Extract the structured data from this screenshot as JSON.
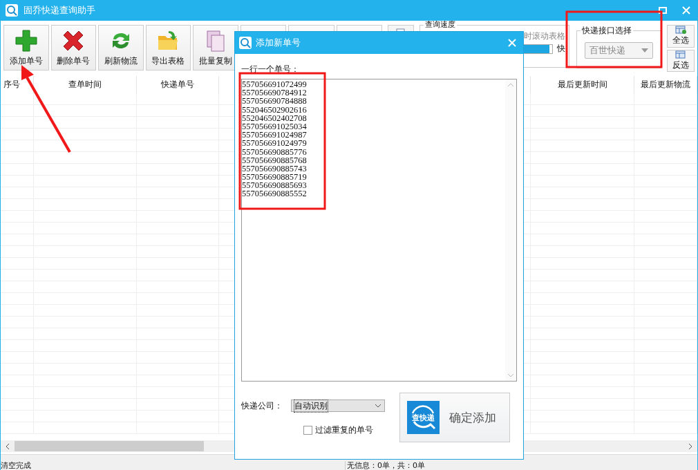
{
  "window": {
    "title": "固乔快递查询助手"
  },
  "toolbar": {
    "buttons": [
      {
        "kind": "add",
        "label": "添加单号"
      },
      {
        "kind": "delete",
        "label": "删除单号"
      },
      {
        "kind": "refresh",
        "label": "刷新物流"
      },
      {
        "kind": "export",
        "label": "导出表格"
      },
      {
        "kind": "copy",
        "label": "批量复制"
      }
    ]
  },
  "speed_group": {
    "title": "查询速度",
    "option_text": "时滚动表格",
    "level": 0.98,
    "end_label": "快"
  },
  "api_group": {
    "title": "快递接口选择",
    "value": "百世快递",
    "disabled": true
  },
  "select_buttons": [
    {
      "kind": "all",
      "label": "全选"
    },
    {
      "kind": "invert",
      "label": "反选"
    }
  ],
  "table": {
    "columns": [
      "序号",
      "查单时间",
      "快递单号",
      "最后更新时间",
      "最后更新物流"
    ]
  },
  "status_bar": {
    "left": "清空完成",
    "right": "无信息：0单，共：0单"
  },
  "dialog": {
    "title": "添加新单号",
    "label": "一行一个单号：",
    "tracking_numbers": [
      "557056691072499",
      "557056690784912",
      "557056690784888",
      "552046502902616",
      "552046502402708",
      "557056691025034",
      "557056691024987",
      "557056691024979",
      "557056690885776",
      "557056690885768",
      "557056690885743",
      "557056690885719",
      "557056690885693",
      "557056690885552"
    ],
    "company_label": "快递公司：",
    "company_value": "自动识别",
    "filter_checkbox": {
      "label": "过滤重复的单号",
      "checked": false
    },
    "confirm_button": {
      "icon_text": "查快递",
      "label": "确定添加"
    }
  }
}
